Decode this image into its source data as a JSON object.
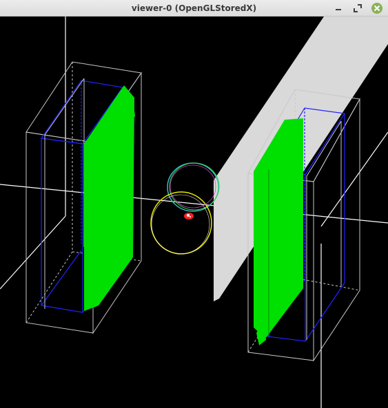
{
  "window": {
    "title": "viewer-0 (OpenGLStoredX)",
    "controls": [
      "minimize",
      "maximize",
      "close"
    ],
    "accent": "#8bb158"
  },
  "scene": {
    "background": "#000000",
    "colors": {
      "axes": "#ffffff",
      "detector_outline": "#c8c8c8",
      "inner_volume": "#2222ff",
      "sensitive_plane": "#00e000",
      "shield_slab": "#d9d9d9",
      "trajectory_circle_1": "#e8e800",
      "trajectory_circle_2": "#33c0c0",
      "source": "#ff2020"
    }
  }
}
